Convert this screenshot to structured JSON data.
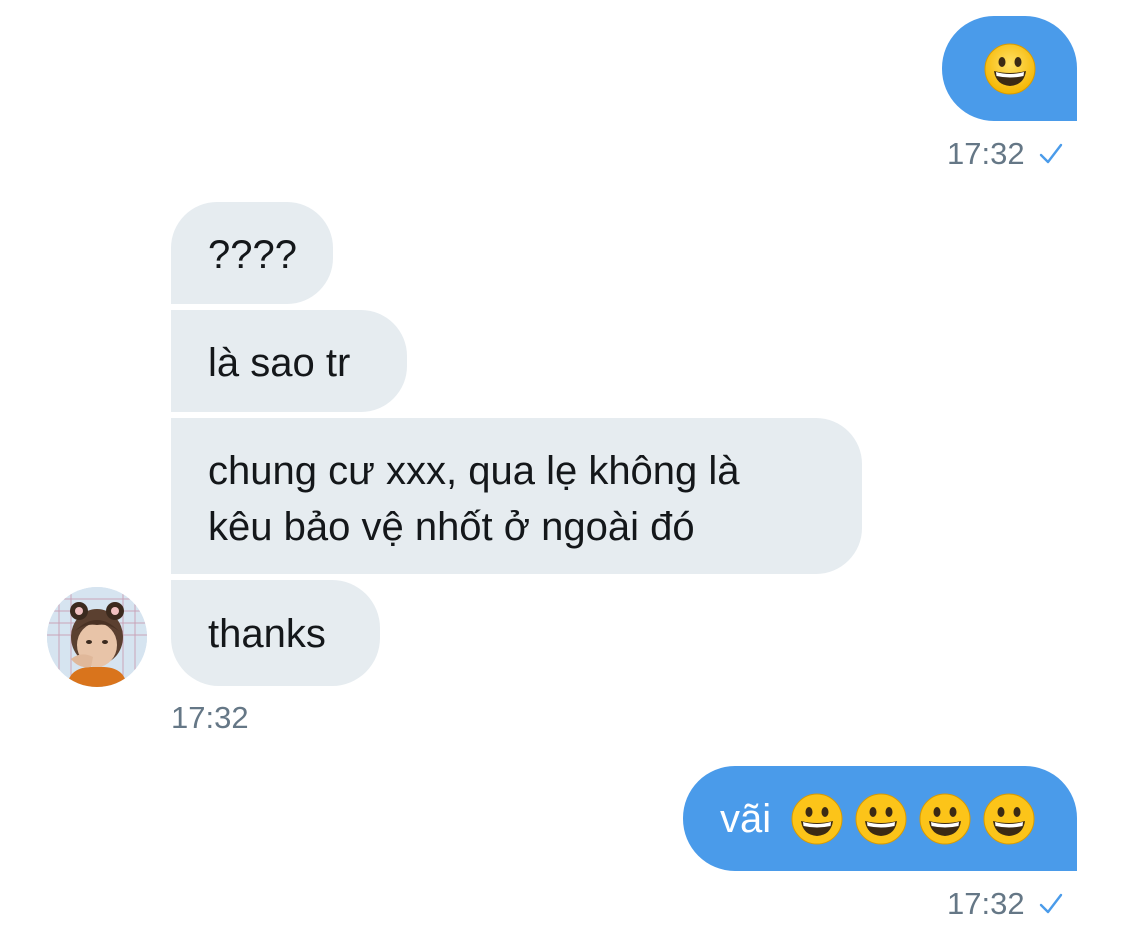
{
  "colors": {
    "incoming_bubble": "#e6ecf0",
    "outgoing_bubble": "#4a9bea",
    "timestamp": "#657786",
    "read_check": "#4a9bea"
  },
  "messages": [
    {
      "direction": "outgoing",
      "emoji": "grinning-face",
      "time": "17:32",
      "status": "read"
    },
    {
      "direction": "incoming",
      "text": "????"
    },
    {
      "direction": "incoming",
      "text": "là sao tr"
    },
    {
      "direction": "incoming",
      "lines": [
        "chung cư xxx, qua lẹ không là",
        "kêu bảo vệ nhốt ở ngoài đó"
      ]
    },
    {
      "direction": "incoming",
      "text": "thanks",
      "time": "17:32",
      "avatar": "sender-avatar"
    },
    {
      "direction": "outgoing",
      "text": "vãi",
      "emoji_count": 4,
      "emoji": "grinning-face",
      "time": "17:32",
      "status": "read"
    }
  ]
}
